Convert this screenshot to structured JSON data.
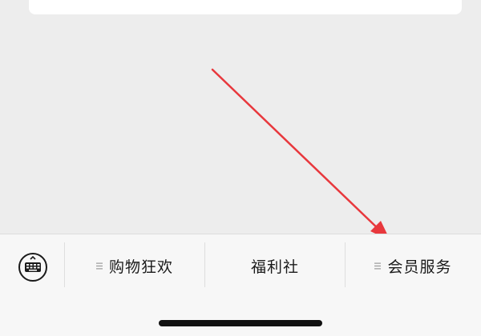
{
  "menu_bar": {
    "items": [
      {
        "label": "购物狂欢",
        "icon": "menu-lines-icon"
      },
      {
        "label": "福利社",
        "icon": ""
      },
      {
        "label": "会员服务",
        "icon": "menu-lines-icon"
      }
    ],
    "keyboard_icon": "keyboard-icon"
  },
  "colors": {
    "background": "#ededed",
    "menu_bar": "#f7f7f7",
    "arrow": "#e8383d",
    "text": "#1a1a1a"
  }
}
